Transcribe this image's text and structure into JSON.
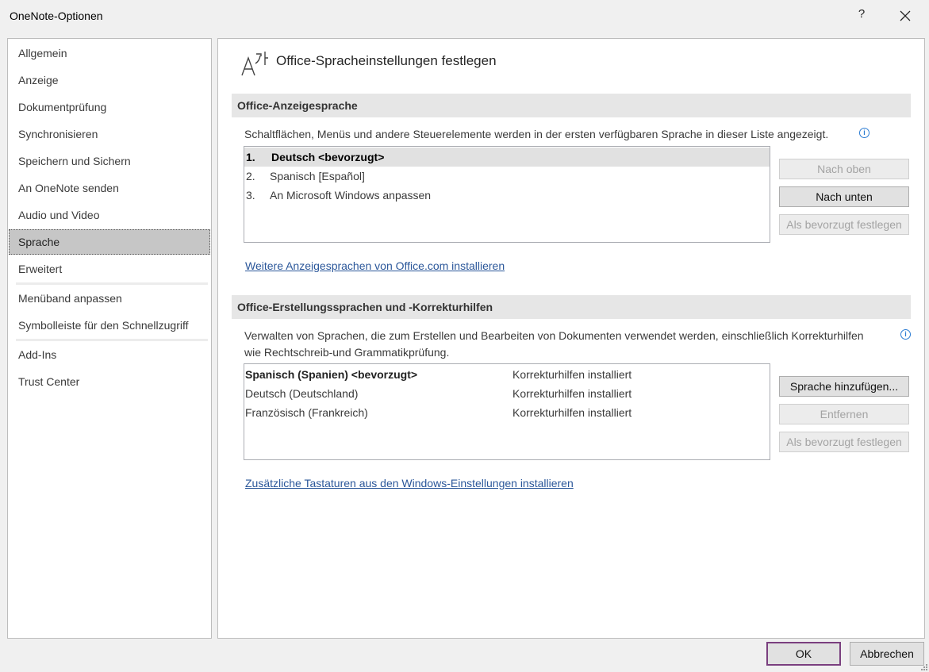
{
  "window": {
    "title": "OneNote-Optionen",
    "help_label": "?",
    "close_icon": "close-icon"
  },
  "sidebar": {
    "items": [
      {
        "label": "Allgemein"
      },
      {
        "label": "Anzeige"
      },
      {
        "label": "Dokumentprüfung"
      },
      {
        "label": "Synchronisieren"
      },
      {
        "label": "Speichern und Sichern"
      },
      {
        "label": "An OneNote senden"
      },
      {
        "label": "Audio und Video"
      },
      {
        "label": "Sprache",
        "selected": true
      },
      {
        "label": "Erweitert"
      },
      {
        "label": "Menüband anpassen"
      },
      {
        "label": "Symbolleiste für den Schnellzugriff"
      },
      {
        "label": "Add-Ins"
      },
      {
        "label": "Trust Center"
      }
    ]
  },
  "main": {
    "header_icon": "language-icon",
    "header_title": "Office-Spracheinstellungen festlegen",
    "display_section": {
      "title": "Office-Anzeigesprache",
      "description": "Schaltflächen, Menüs und andere Steuerelemente werden in der ersten verfügbaren Sprache in dieser Liste angezeigt.",
      "languages": [
        {
          "num": "1.",
          "name": "Deutsch <bevorzugt>"
        },
        {
          "num": "2.",
          "name": "Spanisch [Español]"
        },
        {
          "num": "3.",
          "name": "An Microsoft Windows anpassen"
        }
      ],
      "buttons": {
        "up": "Nach oben",
        "down": "Nach unten",
        "preferred": "Als bevorzugt festlegen"
      },
      "link": "Weitere Anzeigesprachen von Office.com installieren"
    },
    "authoring_section": {
      "title": "Office-Erstellungssprachen und -Korrekturhilfen",
      "description_line1": "Verwalten von Sprachen, die zum Erstellen und Bearbeiten von Dokumenten verwendet werden, einschließlich Korrekturhilfen",
      "description_line2": "wie Rechtschreib-und Grammatikprüfung.",
      "languages": [
        {
          "name": "Spanisch (Spanien) <bevorzugt>",
          "status": "Korrekturhilfen installiert"
        },
        {
          "name": "Deutsch (Deutschland)",
          "status": "Korrekturhilfen installiert"
        },
        {
          "name": "Französisch (Frankreich)",
          "status": "Korrekturhilfen installiert"
        }
      ],
      "buttons": {
        "add": "Sprache hinzufügen...",
        "remove": "Entfernen",
        "preferred": "Als bevorzugt festlegen"
      },
      "link": "Zusätzliche Tastaturen aus den Windows-Einstellungen installieren"
    }
  },
  "footer": {
    "ok": "OK",
    "cancel": "Abbrechen"
  }
}
